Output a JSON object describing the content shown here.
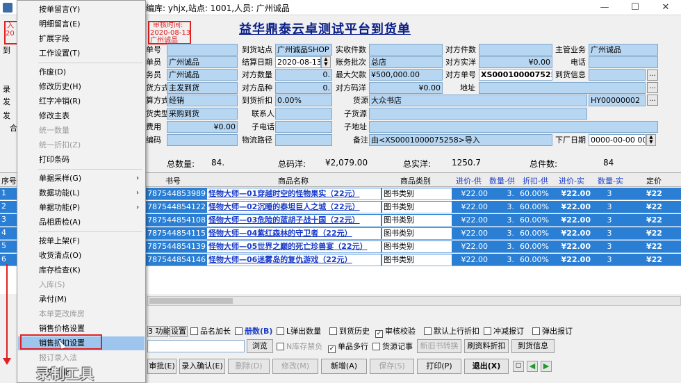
{
  "window": {
    "title": "编库: yhjx,站点: 1001,人员: 广州诚品",
    "minimize": "—",
    "maximize": "☐",
    "close": "✕"
  },
  "stamps": {
    "entry": {
      "label": "入",
      "date": "20"
    },
    "review": {
      "label": "审核时间:",
      "date": "2020-08-13",
      "user": "广州诚品"
    }
  },
  "doc_title": "益华鼎泰云卓测试平台到货单",
  "form": {
    "col1": [
      {
        "label": "单号",
        "value": ""
      },
      {
        "label": "单员",
        "value": "广州诚品"
      },
      {
        "label": "务员",
        "value": "广州诚品"
      },
      {
        "label": "货方式",
        "value": "主发到货"
      },
      {
        "label": "算方式",
        "value": "经销"
      },
      {
        "label": "货类型",
        "value": "采购到货"
      },
      {
        "label": "费用",
        "value": "¥0.00"
      },
      {
        "label": "编码",
        "value": ""
      }
    ],
    "col2": [
      {
        "label": "到货站点",
        "value": "广州诚品SHOP"
      },
      {
        "label": "结算日期",
        "value": "2020-08-13"
      },
      {
        "label": "对方数量",
        "value": "0."
      },
      {
        "label": "对方品种",
        "value": "0."
      },
      {
        "label": "到货折扣",
        "value": "0.00%"
      },
      {
        "label": "联系人",
        "value": ""
      },
      {
        "label": "子电话",
        "value": ""
      },
      {
        "label": "物流路径",
        "value": ""
      }
    ],
    "col3": [
      {
        "label": "实收件数",
        "value": ""
      },
      {
        "label": "账务批次",
        "value": "总店"
      },
      {
        "label": "最大欠款",
        "value": "¥500,000.00"
      },
      {
        "label": "对方码洋",
        "value": "¥0.00"
      },
      {
        "label": "货源",
        "value": "大众书店"
      },
      {
        "label": "子货源",
        "value": ""
      },
      {
        "label": "子地址",
        "value": ""
      },
      {
        "label": "备注",
        "value": "由<XS0001000075258>导入"
      }
    ],
    "col4": [
      {
        "label": "对方件数",
        "value": ""
      },
      {
        "label": "对方实洋",
        "value": "¥0.00"
      },
      {
        "label": "对方单号",
        "value": "XS0001000075258"
      },
      {
        "label": "地址",
        "value": ""
      },
      {
        "label": "",
        "value": "HY00000002"
      },
      {
        "label": "下厂日期",
        "value": "0000-00-00 00:"
      }
    ],
    "col5": [
      {
        "label": "主管业务",
        "value": "广州诚品"
      },
      {
        "label": "电话",
        "value": ""
      },
      {
        "label": "到货信息",
        "value": ""
      }
    ]
  },
  "summary": {
    "qty_label": "总数量:",
    "qty": "84.",
    "list_label": "总码洋:",
    "list": "¥2,079.00",
    "real_label": "总实洋:",
    "real": "1250.7",
    "pieces_label": "总件数:",
    "pieces": "84"
  },
  "grid": {
    "headers": {
      "rownum": "序号",
      "isbn": "书号",
      "name": "商品名称",
      "cat": "商品类别",
      "price": "进价-供",
      "qty": "数量-供",
      "disc": "折扣-供",
      "rprice": "进价-实",
      "rqty": "数量-实",
      "tail": "定价"
    },
    "rows": [
      {
        "n": "1",
        "isbn": "787544853989",
        "name": "怪物大师—01穿越时空的怪物果实（22元）",
        "cat": "图书类别",
        "price": "¥22.00",
        "qty": "3.",
        "disc": "60.00%",
        "rprice": "¥22.00",
        "rqty": "3",
        "tail": "¥22"
      },
      {
        "n": "2",
        "isbn": "787544854122",
        "name": "怪物大师—02沉睡的泰坦巨人之城（22元）",
        "cat": "图书类别",
        "price": "¥22.00",
        "qty": "3.",
        "disc": "60.00%",
        "rprice": "¥22.00",
        "rqty": "3",
        "tail": "¥22"
      },
      {
        "n": "3",
        "isbn": "787544854108",
        "name": "怪物大师—03危险的蓝胡子战十国（22元）",
        "cat": "图书类别",
        "price": "¥22.00",
        "qty": "3.",
        "disc": "60.00%",
        "rprice": "¥22.00",
        "rqty": "3",
        "tail": "¥22"
      },
      {
        "n": "4",
        "isbn": "787544854115",
        "name": "怪物大师—04紫红森林的守卫者（22元）",
        "cat": "图书类别",
        "price": "¥22.00",
        "qty": "3.",
        "disc": "60.00%",
        "rprice": "¥22.00",
        "rqty": "3",
        "tail": "¥22"
      },
      {
        "n": "5",
        "isbn": "787544854139",
        "name": "怪物大师—05世界之巅的死亡珍兽宴（22元）",
        "cat": "图书类别",
        "price": "¥22.00",
        "qty": "3.",
        "disc": "60.00%",
        "rprice": "¥22.00",
        "rqty": "3",
        "tail": "¥22"
      },
      {
        "n": "6",
        "isbn": "787544854146",
        "name": "怪物大师—06迷雾岛的复仇游戏（22元）",
        "cat": "图书类别",
        "price": "¥22.00",
        "qty": "3.",
        "disc": "60.00%",
        "rprice": "¥22.00",
        "rqty": "3",
        "tail": "¥22"
      }
    ]
  },
  "left_strip": [
    "到",
    "录",
    "发",
    "发",
    "合",
    "序号"
  ],
  "options": {
    "func": "3 功能",
    "settings": "设置",
    "items": [
      "品名加长",
      "册数(B)",
      "L弹出数量",
      "到货历史",
      "审核校验",
      "默认上行折扣",
      "冲减报订",
      "弹出报订"
    ],
    "checked": [
      false,
      false,
      false,
      false,
      true,
      false,
      false,
      false
    ],
    "row2": [
      "N库存禁负",
      "单品多行",
      "货源记事"
    ],
    "row2_checked": [
      false,
      true,
      false
    ],
    "browse": "浏览",
    "replace_new": "新旧书转换",
    "refresh_disc": "刷资料折扣",
    "arrival_info": "到货信息"
  },
  "toolbar": {
    "review": "审批(E)",
    "entry_confirm": "录入确认(E)",
    "delete": "删除(D)",
    "modify": "修改(M)",
    "new": "新增(A)",
    "save": "保存(S)",
    "print": "打印(P)",
    "exit": "退出(X)"
  },
  "menu": {
    "items": [
      {
        "label": "按单留言(Y)"
      },
      {
        "label": "明细留言(E)"
      },
      {
        "label": "扩展字段"
      },
      {
        "label": "工作设置(T)"
      },
      {
        "label": "作废(D)"
      },
      {
        "label": "修改历史(H)"
      },
      {
        "label": "红字冲销(R)"
      },
      {
        "label": "修改主表"
      },
      {
        "label": "统一数量",
        "disabled": true
      },
      {
        "label": "统一折扣(Z)",
        "disabled": true
      },
      {
        "label": "打印条码"
      },
      {
        "label": "单据采样(G)",
        "submenu": true
      },
      {
        "label": "数据功能(L)",
        "submenu": true
      },
      {
        "label": "单据功能(P)",
        "submenu": true
      },
      {
        "label": "品相质检(A)"
      },
      {
        "label": "按单上架(F)"
      },
      {
        "label": "收货清点(O)"
      },
      {
        "label": "库存检查(K)"
      },
      {
        "label": "入库(S)",
        "disabled": true
      },
      {
        "label": "承付(M)"
      },
      {
        "label": "本单更改库房",
        "disabled": true
      },
      {
        "label": "销售价格设置"
      },
      {
        "label": "销售折扣设置",
        "highlighted": true
      },
      {
        "label": "报订录入法",
        "disabled": true
      },
      {
        "label": "其它功能"
      }
    ]
  },
  "watermark": "录制工具",
  "colors": {
    "field_bg": "#b7d6f2",
    "row_selected": "#2a7fd4",
    "title_blue": "#0a1e8a",
    "annotation_red": "#e02020"
  }
}
